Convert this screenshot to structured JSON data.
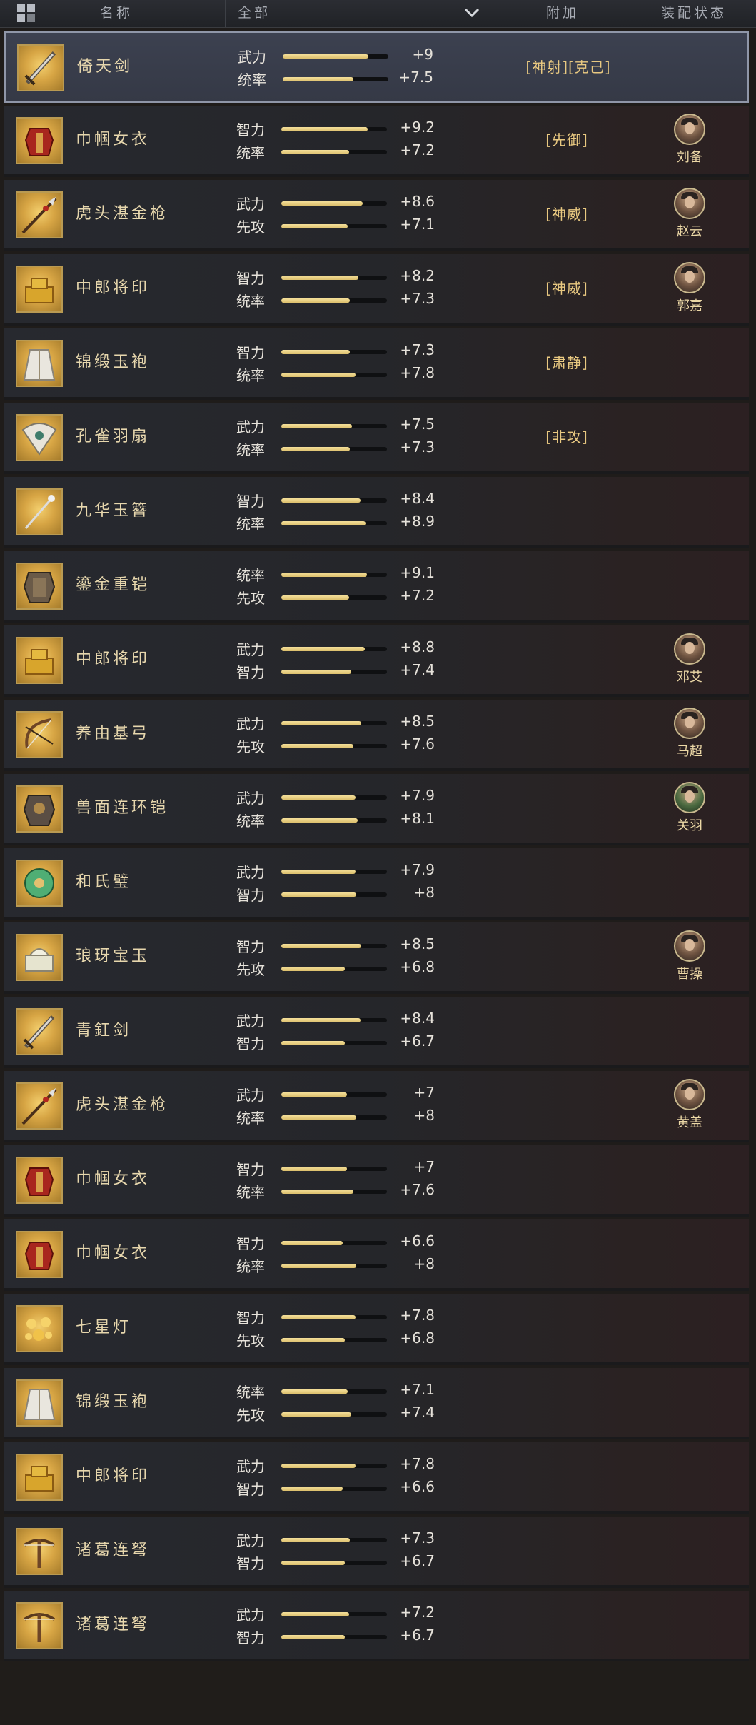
{
  "header": {
    "col_name": "名称",
    "filter_value": "全部",
    "col_bonus": "附加",
    "col_status": "装配状态"
  },
  "items": [
    {
      "name": "倚天剑",
      "icon": "sword-icon",
      "stats": [
        {
          "label": "武力",
          "value": "+9",
          "fill": 0.81
        },
        {
          "label": "统率",
          "value": "+7.5",
          "fill": 0.67
        }
      ],
      "bonus": "[神射][克己]",
      "general": null,
      "selected": true
    },
    {
      "name": "巾帼女衣",
      "icon": "red-armor-icon",
      "stats": [
        {
          "label": "智力",
          "value": "+9.2",
          "fill": 0.82
        },
        {
          "label": "统率",
          "value": "+7.2",
          "fill": 0.64
        }
      ],
      "bonus": "[先御]",
      "general": "刘备",
      "selected": false
    },
    {
      "name": "虎头湛金枪",
      "icon": "spear-icon",
      "stats": [
        {
          "label": "武力",
          "value": "+8.6",
          "fill": 0.77
        },
        {
          "label": "先攻",
          "value": "+7.1",
          "fill": 0.63
        }
      ],
      "bonus": "[神威]",
      "general": "赵云",
      "selected": false
    },
    {
      "name": "中郎将印",
      "icon": "seal-icon",
      "stats": [
        {
          "label": "智力",
          "value": "+8.2",
          "fill": 0.73
        },
        {
          "label": "统率",
          "value": "+7.3",
          "fill": 0.65
        }
      ],
      "bonus": "[神威]",
      "general": "郭嘉",
      "selected": false
    },
    {
      "name": "锦缎玉袍",
      "icon": "robe-icon",
      "stats": [
        {
          "label": "智力",
          "value": "+7.3",
          "fill": 0.65
        },
        {
          "label": "统率",
          "value": "+7.8",
          "fill": 0.7
        }
      ],
      "bonus": "[肃静]",
      "general": null,
      "selected": false
    },
    {
      "name": "孔雀羽扇",
      "icon": "fan-icon",
      "stats": [
        {
          "label": "武力",
          "value": "+7.5",
          "fill": 0.67
        },
        {
          "label": "统率",
          "value": "+7.3",
          "fill": 0.65
        }
      ],
      "bonus": "[非攻]",
      "general": null,
      "selected": false
    },
    {
      "name": "九华玉簪",
      "icon": "hairpin-icon",
      "stats": [
        {
          "label": "智力",
          "value": "+8.4",
          "fill": 0.75
        },
        {
          "label": "统率",
          "value": "+8.9",
          "fill": 0.8
        }
      ],
      "bonus": "",
      "general": null,
      "selected": false
    },
    {
      "name": "鎏金重铠",
      "icon": "heavy-armor-icon",
      "stats": [
        {
          "label": "统率",
          "value": "+9.1",
          "fill": 0.81
        },
        {
          "label": "先攻",
          "value": "+7.2",
          "fill": 0.64
        }
      ],
      "bonus": "",
      "general": null,
      "selected": false
    },
    {
      "name": "中郎将印",
      "icon": "seal-icon",
      "stats": [
        {
          "label": "武力",
          "value": "+8.8",
          "fill": 0.79
        },
        {
          "label": "智力",
          "value": "+7.4",
          "fill": 0.66
        }
      ],
      "bonus": "",
      "general": "邓艾",
      "selected": false
    },
    {
      "name": "养由基弓",
      "icon": "bow-icon",
      "stats": [
        {
          "label": "武力",
          "value": "+8.5",
          "fill": 0.76
        },
        {
          "label": "先攻",
          "value": "+7.6",
          "fill": 0.68
        }
      ],
      "bonus": "",
      "general": "马超",
      "selected": false
    },
    {
      "name": "兽面连环铠",
      "icon": "beast-armor-icon",
      "stats": [
        {
          "label": "武力",
          "value": "+7.9",
          "fill": 0.7
        },
        {
          "label": "统率",
          "value": "+8.1",
          "fill": 0.72
        }
      ],
      "bonus": "",
      "general": "关羽",
      "selected": false
    },
    {
      "name": "和氏璧",
      "icon": "jade-disc-icon",
      "stats": [
        {
          "label": "武力",
          "value": "+7.9",
          "fill": 0.7
        },
        {
          "label": "智力",
          "value": "+8",
          "fill": 0.71
        }
      ],
      "bonus": "",
      "general": null,
      "selected": false
    },
    {
      "name": "琅玡宝玉",
      "icon": "jade-seal-icon",
      "stats": [
        {
          "label": "智力",
          "value": "+8.5",
          "fill": 0.76
        },
        {
          "label": "先攻",
          "value": "+6.8",
          "fill": 0.6
        }
      ],
      "bonus": "",
      "general": "曹操",
      "selected": false
    },
    {
      "name": "青釭剑",
      "icon": "sword-icon",
      "stats": [
        {
          "label": "武力",
          "value": "+8.4",
          "fill": 0.75
        },
        {
          "label": "智力",
          "value": "+6.7",
          "fill": 0.6
        }
      ],
      "bonus": "",
      "general": null,
      "selected": false
    },
    {
      "name": "虎头湛金枪",
      "icon": "spear-icon",
      "stats": [
        {
          "label": "武力",
          "value": "+7",
          "fill": 0.62
        },
        {
          "label": "统率",
          "value": "+8",
          "fill": 0.71
        }
      ],
      "bonus": "",
      "general": "黄盖",
      "selected": false
    },
    {
      "name": "巾帼女衣",
      "icon": "red-armor-icon",
      "stats": [
        {
          "label": "智力",
          "value": "+7",
          "fill": 0.62
        },
        {
          "label": "统率",
          "value": "+7.6",
          "fill": 0.68
        }
      ],
      "bonus": "",
      "general": null,
      "selected": false
    },
    {
      "name": "巾帼女衣",
      "icon": "red-armor-icon",
      "stats": [
        {
          "label": "智力",
          "value": "+6.6",
          "fill": 0.58
        },
        {
          "label": "统率",
          "value": "+8",
          "fill": 0.71
        }
      ],
      "bonus": "",
      "general": null,
      "selected": false
    },
    {
      "name": "七星灯",
      "icon": "lamp-icon",
      "stats": [
        {
          "label": "智力",
          "value": "+7.8",
          "fill": 0.7
        },
        {
          "label": "先攻",
          "value": "+6.8",
          "fill": 0.6
        }
      ],
      "bonus": "",
      "general": null,
      "selected": false
    },
    {
      "name": "锦缎玉袍",
      "icon": "robe-icon",
      "stats": [
        {
          "label": "统率",
          "value": "+7.1",
          "fill": 0.63
        },
        {
          "label": "先攻",
          "value": "+7.4",
          "fill": 0.66
        }
      ],
      "bonus": "",
      "general": null,
      "selected": false
    },
    {
      "name": "中郎将印",
      "icon": "seal-icon",
      "stats": [
        {
          "label": "武力",
          "value": "+7.8",
          "fill": 0.7
        },
        {
          "label": "智力",
          "value": "+6.6",
          "fill": 0.58
        }
      ],
      "bonus": "",
      "general": null,
      "selected": false
    },
    {
      "name": "诸葛连弩",
      "icon": "crossbow-icon",
      "stats": [
        {
          "label": "武力",
          "value": "+7.3",
          "fill": 0.65
        },
        {
          "label": "智力",
          "value": "+6.7",
          "fill": 0.6
        }
      ],
      "bonus": "",
      "general": null,
      "selected": false
    },
    {
      "name": "诸葛连弩",
      "icon": "crossbow-icon",
      "stats": [
        {
          "label": "武力",
          "value": "+7.2",
          "fill": 0.64
        },
        {
          "label": "智力",
          "value": "+6.7",
          "fill": 0.6
        }
      ],
      "bonus": "",
      "general": null,
      "selected": false
    }
  ]
}
